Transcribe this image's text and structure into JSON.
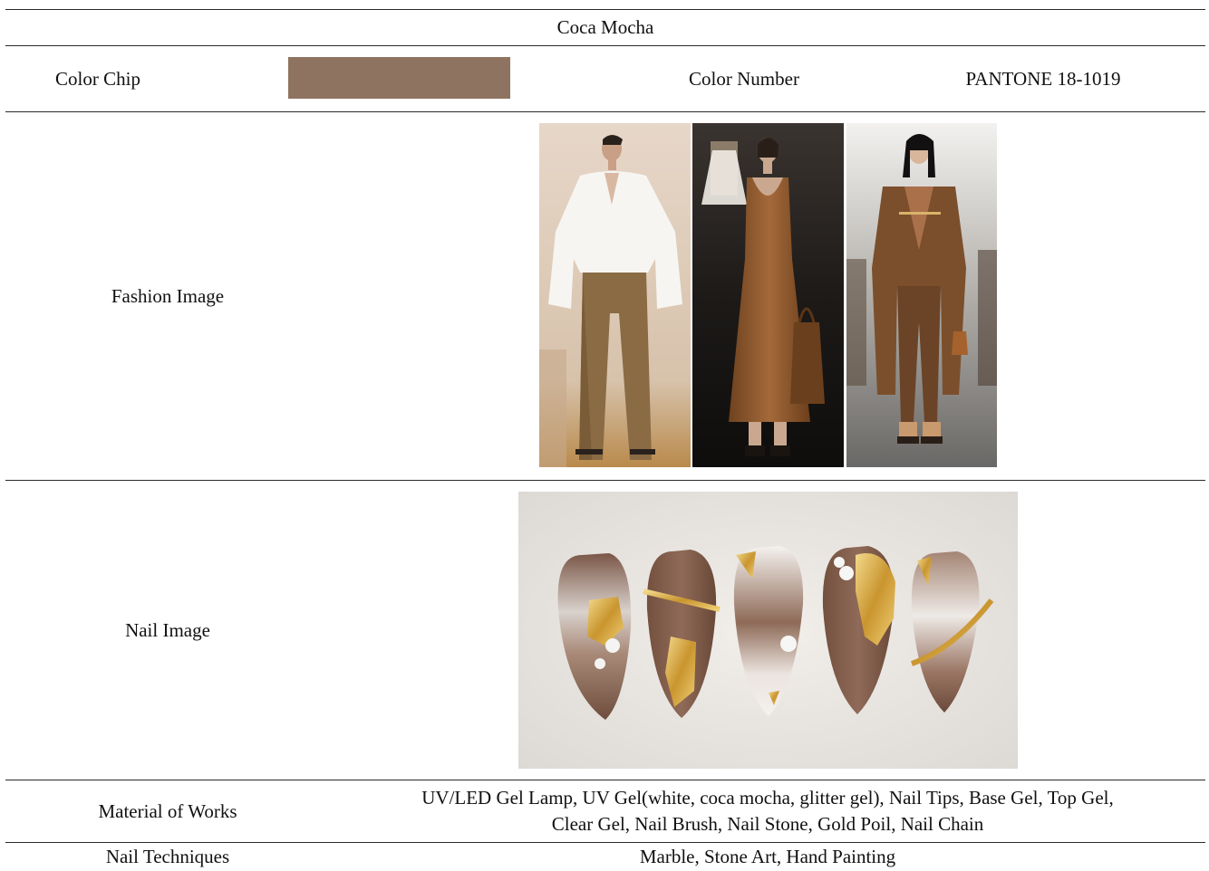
{
  "title": "Coca Mocha",
  "color_chip": {
    "label": "Color Chip",
    "hex": "#8E7360"
  },
  "color_number": {
    "label": "Color Number",
    "value": "PANTONE 18-1019"
  },
  "fashion_image": {
    "label": "Fashion Image",
    "photos": [
      "runway-photo-white-blouse-brown-trousers",
      "runway-photo-brown-leather-dress",
      "runway-photo-brown-suit-coat"
    ]
  },
  "nail_image": {
    "label": "Nail Image",
    "photo": "nail-art-photo-five-almond-nails"
  },
  "material": {
    "label": "Material of Works",
    "line1": "UV/LED Gel Lamp, UV Gel(white, coca mocha, glitter gel), Nail Tips, Base Gel, Top Gel,",
    "line2": "Clear Gel, Nail Brush, Nail Stone, Gold Poil, Nail Chain"
  },
  "techniques": {
    "label": "Nail Techniques",
    "value": "Marble, Stone Art, Hand Painting"
  }
}
